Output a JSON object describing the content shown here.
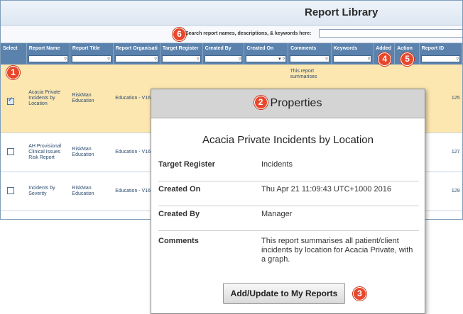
{
  "library": {
    "title": "Report Library",
    "search_label": "Search report names, descriptions, & keywords here:",
    "search_value": ""
  },
  "columns": [
    "Select",
    "Report Name",
    "Report Title",
    "Report Organisati",
    "Target Register",
    "Created By",
    "Created On",
    "Comments",
    "Keywords",
    "Added",
    "Action",
    "Report ID"
  ],
  "rows": [
    {
      "selected": true,
      "name": "Acacia Private Incidents by Location",
      "title": "RiskMan Education",
      "org": "Education - V16",
      "comments": "This report summarises",
      "id": "125"
    },
    {
      "selected": false,
      "name": "AH Provisional Clinical Issues Risk Report",
      "title": "RiskMan Education",
      "org": "Education - V16",
      "comments": "",
      "id": "127"
    },
    {
      "selected": false,
      "name": "Incidents by Severity",
      "title": "RiskMan Education",
      "org": "Education - V16",
      "comments": "",
      "id": "129"
    }
  ],
  "badges": {
    "one": "1",
    "two": "2",
    "three": "3",
    "four": "4",
    "five": "5",
    "six": "6"
  },
  "properties": {
    "header": "Properties",
    "report_title": "Acacia Private Incidents by Location",
    "fields": [
      {
        "key": "Target Register",
        "value": "Incidents"
      },
      {
        "key": "Created On",
        "value": "Thu Apr 21 11:09:43 UTC+1000 2016"
      },
      {
        "key": "Created By",
        "value": "Manager"
      },
      {
        "key": "Comments",
        "value": "This report summarises all patient/client incidents by location for Acacia Private, with a graph."
      }
    ],
    "button": "Add/Update to My Reports"
  },
  "colors": {
    "badge": "#e8472b",
    "header_blue": "#5a82ad",
    "selected_row": "#fde7b0"
  }
}
